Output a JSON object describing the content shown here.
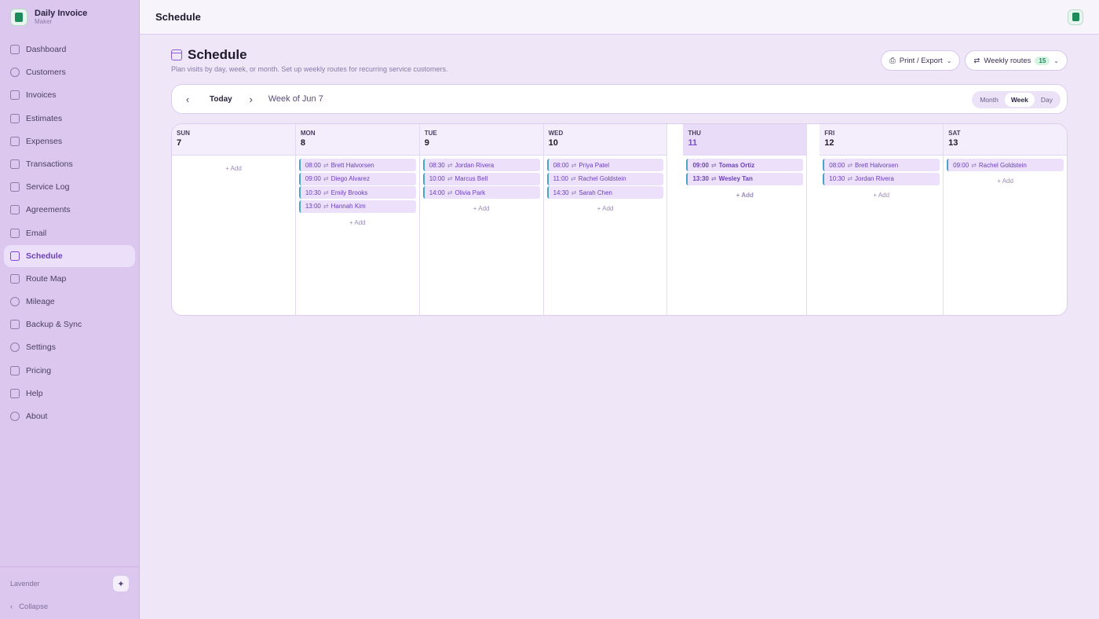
{
  "brand": {
    "title": "Daily Invoice",
    "subtitle": "Maker"
  },
  "sidebar": {
    "items": [
      {
        "label": "Dashboard",
        "icon": "grid-icon"
      },
      {
        "label": "Customers",
        "icon": "users-icon"
      },
      {
        "label": "Invoices",
        "icon": "file-icon"
      },
      {
        "label": "Estimates",
        "icon": "file-estimate-icon"
      },
      {
        "label": "Expenses",
        "icon": "receipt-icon"
      },
      {
        "label": "Transactions",
        "icon": "card-icon"
      },
      {
        "label": "Service Log",
        "icon": "clipboard-icon"
      },
      {
        "label": "Agreements",
        "icon": "signature-icon"
      },
      {
        "label": "Email",
        "icon": "mail-icon"
      },
      {
        "label": "Schedule",
        "icon": "calendar-icon",
        "active": true
      },
      {
        "label": "Route Map",
        "icon": "map-icon"
      },
      {
        "label": "Mileage",
        "icon": "pin-icon"
      },
      {
        "label": "Backup & Sync",
        "icon": "drive-icon"
      },
      {
        "label": "Settings",
        "icon": "gear-icon"
      },
      {
        "label": "Pricing",
        "icon": "crown-icon"
      },
      {
        "label": "Help",
        "icon": "book-icon"
      },
      {
        "label": "About",
        "icon": "info-icon"
      }
    ],
    "theme_label": "Lavender",
    "collapse_label": "Collapse"
  },
  "topbar": {
    "title": "Schedule"
  },
  "page": {
    "title": "Schedule",
    "subtitle": "Plan visits by day, week, or month. Set up weekly routes for recurring service customers.",
    "print_label": "Print / Export",
    "routes_label": "Weekly routes",
    "routes_count": "15"
  },
  "toolbar": {
    "today_label": "Today",
    "week_label": "Week of Jun 7",
    "views": [
      "Month",
      "Week",
      "Day"
    ],
    "active_view": "Week"
  },
  "calendar": {
    "add_label": "+ Add",
    "today_index": 4,
    "days": [
      {
        "dow": "SUN",
        "num": "7",
        "events": []
      },
      {
        "dow": "MON",
        "num": "8",
        "events": [
          {
            "time": "08:00",
            "name": "Brett Halvorsen"
          },
          {
            "time": "09:00",
            "name": "Diego Alvarez"
          },
          {
            "time": "10:30",
            "name": "Emily Brooks"
          },
          {
            "time": "13:00",
            "name": "Hannah Kim"
          }
        ]
      },
      {
        "dow": "TUE",
        "num": "9",
        "events": [
          {
            "time": "08:30",
            "name": "Jordan Rivera"
          },
          {
            "time": "10:00",
            "name": "Marcus Bell"
          },
          {
            "time": "14:00",
            "name": "Olivia Park"
          }
        ]
      },
      {
        "dow": "WED",
        "num": "10",
        "events": [
          {
            "time": "08:00",
            "name": "Priya Patel"
          },
          {
            "time": "11:00",
            "name": "Rachel Goldstein"
          },
          {
            "time": "14:30",
            "name": "Sarah Chen"
          }
        ]
      },
      {
        "dow": "THU",
        "num": "11",
        "events": [
          {
            "time": "09:00",
            "name": "Tomas Ortiz"
          },
          {
            "time": "13:30",
            "name": "Wesley Tan"
          }
        ]
      },
      {
        "dow": "FRI",
        "num": "12",
        "events": [
          {
            "time": "08:00",
            "name": "Brett Halvorsen"
          },
          {
            "time": "10:30",
            "name": "Jordan Rivera"
          }
        ]
      },
      {
        "dow": "SAT",
        "num": "13",
        "events": [
          {
            "time": "09:00",
            "name": "Rachel Goldstein"
          }
        ]
      }
    ]
  }
}
